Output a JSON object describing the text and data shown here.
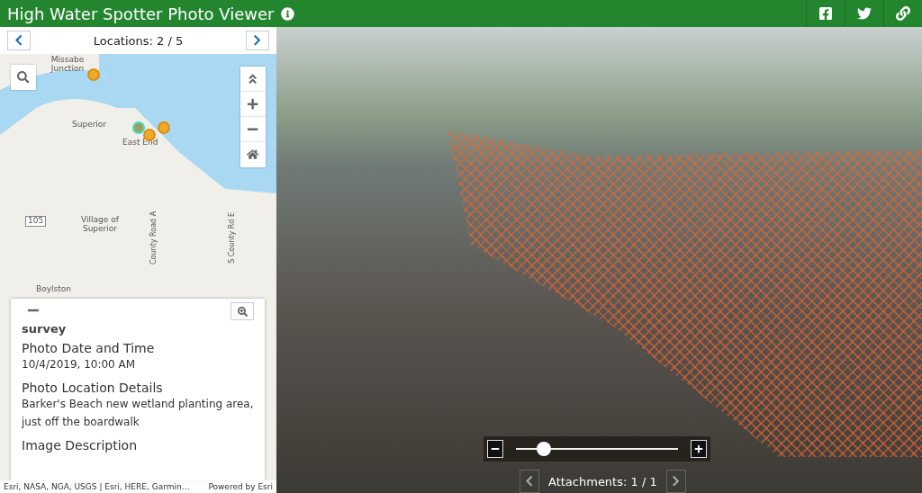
{
  "header": {
    "title": "High Water Spotter Photo Viewer",
    "share": [
      {
        "kind": "facebook"
      },
      {
        "kind": "twitter"
      },
      {
        "kind": "link"
      }
    ]
  },
  "locations": {
    "label": "Locations: 2 / 5"
  },
  "map": {
    "labels": [
      {
        "text": "Missabe Junction",
        "kind": "place"
      },
      {
        "text": "Superior",
        "kind": "place"
      },
      {
        "text": "East End",
        "kind": "place"
      },
      {
        "text": "105",
        "kind": "shield"
      },
      {
        "text": "Village of Superior",
        "kind": "place"
      },
      {
        "text": "County Road A",
        "kind": "road"
      },
      {
        "text": "S County Rd E",
        "kind": "road"
      },
      {
        "text": "Boylston",
        "kind": "place"
      }
    ],
    "points": [
      {
        "selected": false
      },
      {
        "selected": true
      },
      {
        "selected": false
      },
      {
        "selected": false
      }
    ],
    "attribution": "Esri, NASA, NGA, USGS | Esri, HERE, Garmin…",
    "powered": "Powered by Esri"
  },
  "popup": {
    "layer": "survey",
    "fields": [
      {
        "label": "Photo Date and Time",
        "value": "10/4/2019, 10:00 AM"
      },
      {
        "label": "Photo Location Details",
        "value": "Barker's Beach new wetland planting area, just off the boardwalk"
      },
      {
        "label": "Image Description"
      }
    ]
  },
  "viewer": {
    "zoom": {
      "level": 0.17
    },
    "attachments": "Attachments: 1 / 1"
  }
}
